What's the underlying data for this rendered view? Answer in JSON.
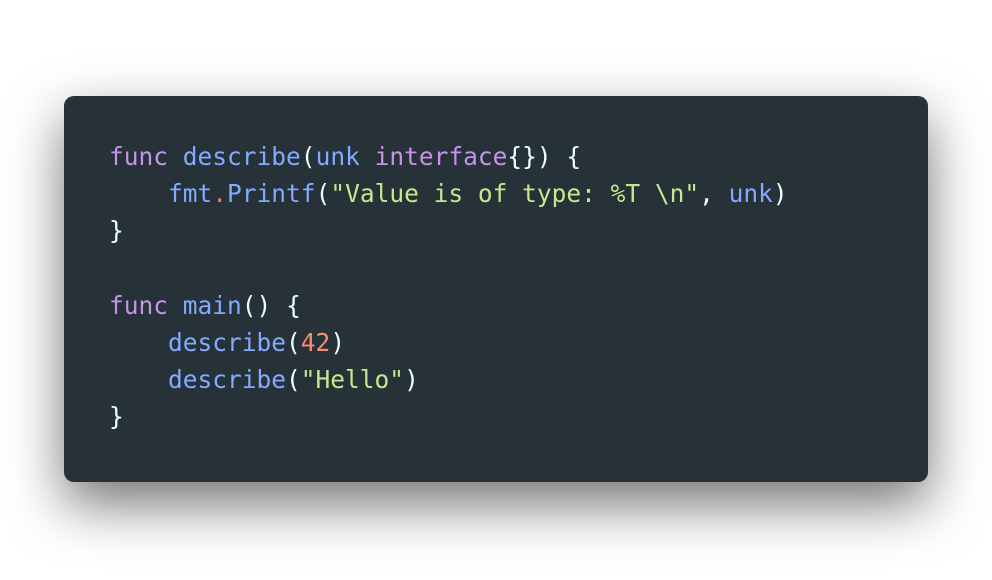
{
  "code": {
    "lines": [
      [
        {
          "text": "func",
          "kind": "keyword"
        },
        {
          "text": " ",
          "kind": "plain"
        },
        {
          "text": "describe",
          "kind": "function"
        },
        {
          "text": "(",
          "kind": "punct"
        },
        {
          "text": "unk",
          "kind": "param"
        },
        {
          "text": " ",
          "kind": "plain"
        },
        {
          "text": "interface",
          "kind": "type"
        },
        {
          "text": "{}",
          "kind": "punct"
        },
        {
          "text": ")",
          "kind": "punct"
        },
        {
          "text": " {",
          "kind": "punct"
        }
      ],
      [
        {
          "text": "    ",
          "kind": "plain"
        },
        {
          "text": "fmt",
          "kind": "ident"
        },
        {
          "text": ".",
          "kind": "operator"
        },
        {
          "text": "Printf",
          "kind": "function"
        },
        {
          "text": "(",
          "kind": "punct"
        },
        {
          "text": "\"Value is of type: %T \\n\"",
          "kind": "string"
        },
        {
          "text": ", ",
          "kind": "punct"
        },
        {
          "text": "unk",
          "kind": "ident"
        },
        {
          "text": ")",
          "kind": "punct"
        }
      ],
      [
        {
          "text": "}",
          "kind": "punct"
        }
      ],
      [],
      [
        {
          "text": "func",
          "kind": "keyword"
        },
        {
          "text": " ",
          "kind": "plain"
        },
        {
          "text": "main",
          "kind": "function"
        },
        {
          "text": "()",
          "kind": "punct"
        },
        {
          "text": " {",
          "kind": "punct"
        }
      ],
      [
        {
          "text": "    ",
          "kind": "plain"
        },
        {
          "text": "describe",
          "kind": "function"
        },
        {
          "text": "(",
          "kind": "punct"
        },
        {
          "text": "42",
          "kind": "number"
        },
        {
          "text": ")",
          "kind": "punct"
        }
      ],
      [
        {
          "text": "    ",
          "kind": "plain"
        },
        {
          "text": "describe",
          "kind": "function"
        },
        {
          "text": "(",
          "kind": "punct"
        },
        {
          "text": "\"Hello\"",
          "kind": "string"
        },
        {
          "text": ")",
          "kind": "punct"
        }
      ],
      [
        {
          "text": "}",
          "kind": "punct"
        }
      ]
    ]
  },
  "colors": {
    "card_background": "#263238",
    "keyword": "#c792ea",
    "function": "#82aaff",
    "string": "#c3e88d",
    "number": "#f78c6c",
    "operator": "#f07178",
    "text": "#eeffff"
  }
}
